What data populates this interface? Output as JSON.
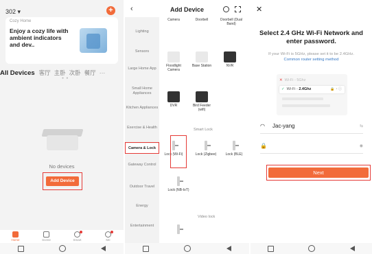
{
  "home": {
    "home_name": "302 ▾",
    "banner_small": "Cozy Home",
    "banner_title": "Enjoy a cozy life with ambient indicators and dev..",
    "rooms": [
      "All Devices",
      "客厅",
      "主卧",
      "次卧",
      "餐厅",
      "···"
    ],
    "empty_text": "No devices",
    "add_device_label": "Add Device",
    "tabs": [
      "Home",
      "Scene",
      "Smart",
      "Me"
    ]
  },
  "add_device": {
    "title": "Add Device",
    "categories": [
      "Lighting",
      "Sensors",
      "Large Home App",
      "Small Home Appliances",
      "Kitchen Appliances",
      "Exercise & Health",
      "Camera & Lock",
      "Gateway Control",
      "Outdoor Travel",
      "Energy",
      "Entertainment"
    ],
    "top_devices": [
      "Camera",
      "Doorbell",
      "Doorbell (Dual Band)"
    ],
    "row_devices": [
      "Floodlight Camera",
      "Base Station",
      "NVR"
    ],
    "row2_devices": [
      "DVR",
      "Bird Feeder (wifi)"
    ],
    "smart_lock_header": "Smart Lock",
    "locks": [
      "Lock (Wi-Fi)",
      "Lock (Zigbee)",
      "Lock (BLE)"
    ],
    "lock_nb": "Lock (NB-IoT)",
    "video_lock_header": "Video lock"
  },
  "wifi": {
    "title": "Select 2.4 GHz Wi-Fi Network and enter password.",
    "subtitle": "If your Wi-Fi is 5GHz, please set it to be 2.4GHz.",
    "link": "Common router setting method",
    "bad_option": "Wi-Fi - 5Ghz",
    "good_option_prefix": "Wi-Fi - ",
    "good_option_band": "2.4Ghz",
    "ssid": "Jac-yang",
    "ssid_action": "⇆",
    "next_label": "Next"
  },
  "colors": {
    "accent": "#f26b3a",
    "highlight": "#e53935"
  }
}
